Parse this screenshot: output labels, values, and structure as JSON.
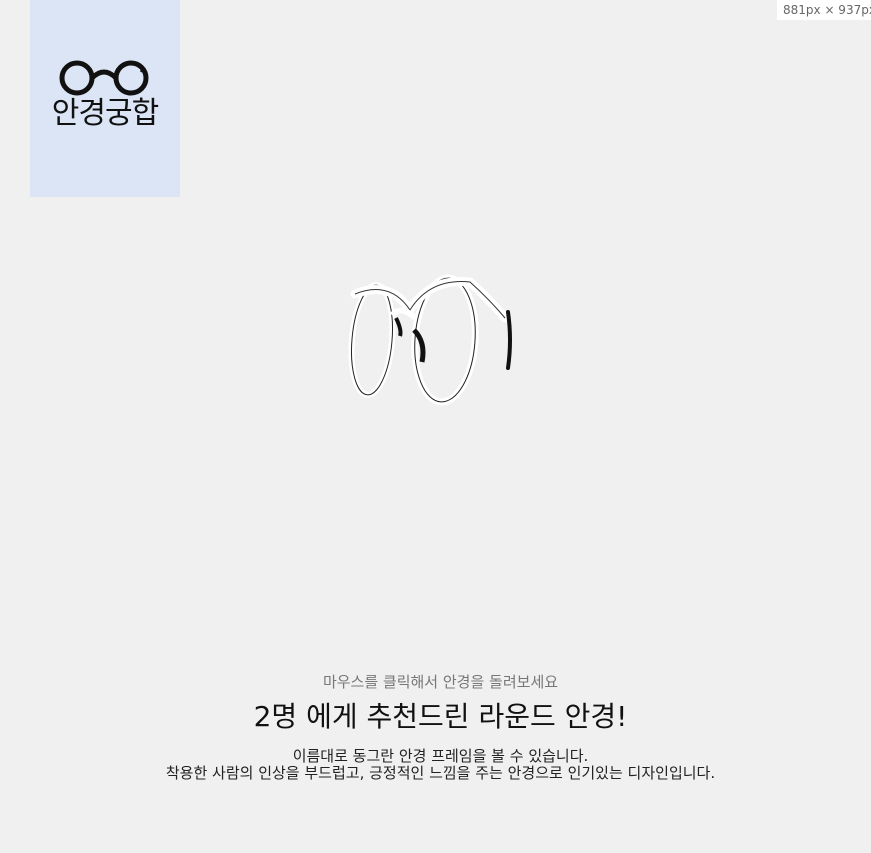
{
  "viewport_indicator": "881px × 937px",
  "logo": {
    "text": "안경궁합",
    "icon": "round-glasses-icon",
    "background": "#dbe5f6"
  },
  "viewer": {
    "icon": "round-glasses-3d-model"
  },
  "content": {
    "hint": "마우스를 클릭해서 안경을 돌려보세요",
    "headline": "2명 에게 추천드린 라운드 안경!",
    "description_line1": "이름대로 동그란 안경 프레임을 볼 수 있습니다.",
    "description_line2": "착용한 사람의 인상을 부드럽고, 긍정적인 느낌을 주는 안경으로 인기있는 디자인입니다."
  },
  "colors": {
    "page_background": "#f0f0f0",
    "logo_background": "#dbe5f6"
  }
}
